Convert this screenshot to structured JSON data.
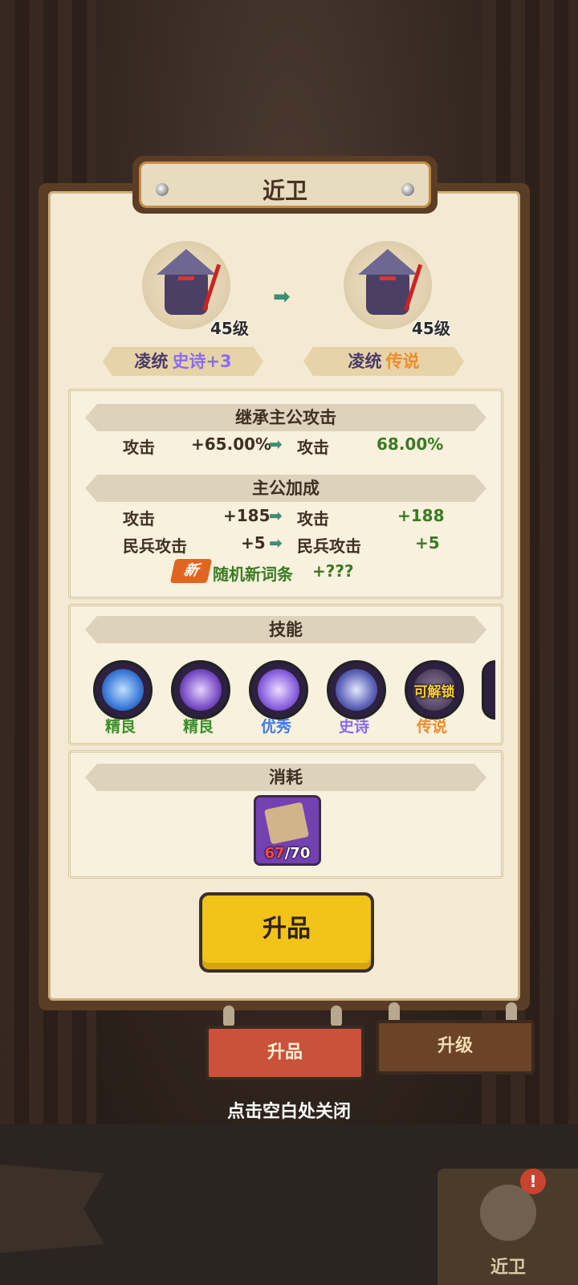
{
  "title": "近卫",
  "hero_left": {
    "level": "45级",
    "name": "凌统",
    "grade": "史诗+3",
    "grade_color": "#8a6cf0"
  },
  "hero_right": {
    "level": "45级",
    "name": "凌统",
    "grade": "传说",
    "grade_color": "#f08c2a"
  },
  "inherit": {
    "header": "继承主公攻击",
    "rows": [
      {
        "label": "攻击",
        "from": "+65.00%",
        "to_label": "攻击",
        "to": "68.00%"
      }
    ]
  },
  "bonus": {
    "header": "主公加成",
    "rows": [
      {
        "label": "攻击",
        "from": "+185",
        "to_label": "攻击",
        "to": "+188"
      },
      {
        "label": "民兵攻击",
        "from": "+5",
        "to_label": "民兵攻击",
        "to": "+5"
      }
    ],
    "new_badge": "新",
    "new_label": "随机新词条",
    "new_value": "+???"
  },
  "skills": {
    "header": "技能",
    "items": [
      {
        "label": "精良",
        "color": "#3b8f2a",
        "glow": "#3c7bd9"
      },
      {
        "label": "精良",
        "color": "#3b8f2a",
        "glow": "#7b4fc7"
      },
      {
        "label": "优秀",
        "color": "#3f7be0",
        "glow": "#8a62e0"
      },
      {
        "label": "史诗",
        "color": "#8a6cf0",
        "glow": "#5c63b8"
      },
      {
        "label": "传说",
        "color": "#f08c2a",
        "glow": "#5a4a6a",
        "overlay": "可解锁"
      }
    ]
  },
  "cost": {
    "header": "消耗",
    "have": "67",
    "need": "/70"
  },
  "upgrade_button": "升品",
  "tabs": {
    "active": "升品",
    "inactive": "升级"
  },
  "hint": "点击空白处关闭",
  "bottom_hero_label": "近卫",
  "bottom_alert": "!"
}
